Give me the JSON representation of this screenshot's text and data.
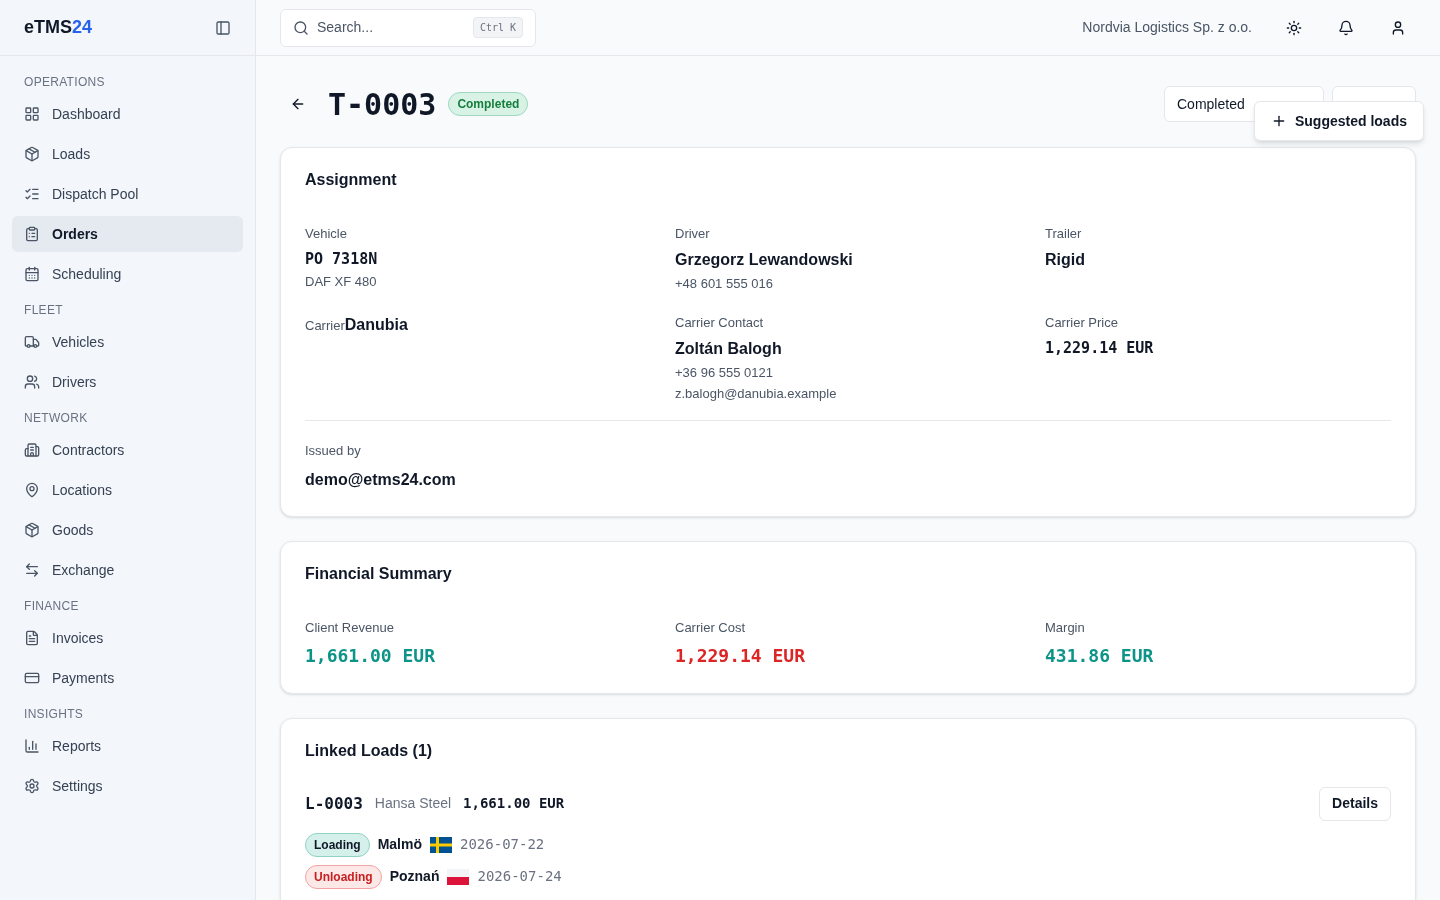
{
  "sidebar": {
    "logo": {
      "text": "eTMS",
      "accent": "24"
    },
    "sections": [
      {
        "title": "OPERATIONS",
        "items": [
          {
            "label": "Dashboard",
            "selected": false
          },
          {
            "label": "Loads",
            "selected": false
          },
          {
            "label": "Dispatch Pool",
            "selected": false
          },
          {
            "label": "Orders",
            "selected": true
          },
          {
            "label": "Scheduling",
            "selected": false
          }
        ]
      },
      {
        "title": "FLEET",
        "items": [
          {
            "label": "Vehicles",
            "selected": false
          },
          {
            "label": "Drivers",
            "selected": false
          }
        ]
      },
      {
        "title": "NETWORK",
        "items": [
          {
            "label": "Contractors",
            "selected": false
          },
          {
            "label": "Locations",
            "selected": false
          },
          {
            "label": "Goods",
            "selected": false
          },
          {
            "label": "Exchange",
            "selected": false
          }
        ]
      },
      {
        "title": "FINANCE",
        "items": [
          {
            "label": "Invoices",
            "selected": false
          },
          {
            "label": "Payments",
            "selected": false
          }
        ]
      },
      {
        "title": "INSIGHTS",
        "items": [
          {
            "label": "Reports",
            "selected": false
          },
          {
            "label": "Settings",
            "selected": false
          }
        ]
      }
    ]
  },
  "header": {
    "search": {
      "placeholder": "Search...",
      "shortcut": "Ctrl K"
    },
    "company": "Nordvia Logistics Sp. z o.o."
  },
  "page": {
    "title": "T-0003",
    "status": "Completed",
    "status_select": "Completed",
    "popup_button": "Suggested loads"
  },
  "assignment": {
    "title": "Assignment",
    "fields": [
      {
        "kind": "mono",
        "label": "Vehicle",
        "value": "PO 7318N",
        "lines": [
          "DAF XF 480"
        ]
      },
      {
        "kind": "stack",
        "label": "Driver",
        "value": "Grzegorz Lewandowski",
        "lines": [
          "+48 601 555 016"
        ]
      },
      {
        "kind": "stack",
        "label": "Trailer",
        "value": "Rigid"
      },
      {
        "kind": "inline",
        "label": "Carrier",
        "value": "Danubia"
      },
      {
        "kind": "stack",
        "label": "Carrier Contact",
        "value": "Zoltán Balogh",
        "lines": [
          "+36 96 555 0121",
          "z.balogh@danubia.example"
        ]
      },
      {
        "kind": "mono",
        "label": "Carrier Price",
        "value": "1,229.14 EUR"
      }
    ],
    "issued": {
      "label": "Issued by",
      "value": "demo@etms24.com"
    }
  },
  "financial": {
    "title": "Financial Summary",
    "items": [
      {
        "label": "Client Revenue",
        "value": "1,661.00 EUR",
        "color": "#0d9488"
      },
      {
        "label": "Carrier Cost",
        "value": "1,229.14 EUR",
        "color": "#dc2626"
      },
      {
        "label": "Margin",
        "value": "431.86 EUR",
        "color": "#0d9488"
      }
    ]
  },
  "linked": {
    "title": "Linked Loads (1)",
    "loads": [
      {
        "id": "L-0003",
        "client": "Hansa Steel",
        "amount": "1,661.00 EUR",
        "button": "Details",
        "stops": [
          {
            "kind": "loading",
            "label": "Loading",
            "city": "Malmö",
            "date": "2026-07-22"
          },
          {
            "kind": "unloading",
            "label": "Unloading",
            "city": "Poznań",
            "date": "2026-07-24"
          }
        ]
      }
    ]
  }
}
